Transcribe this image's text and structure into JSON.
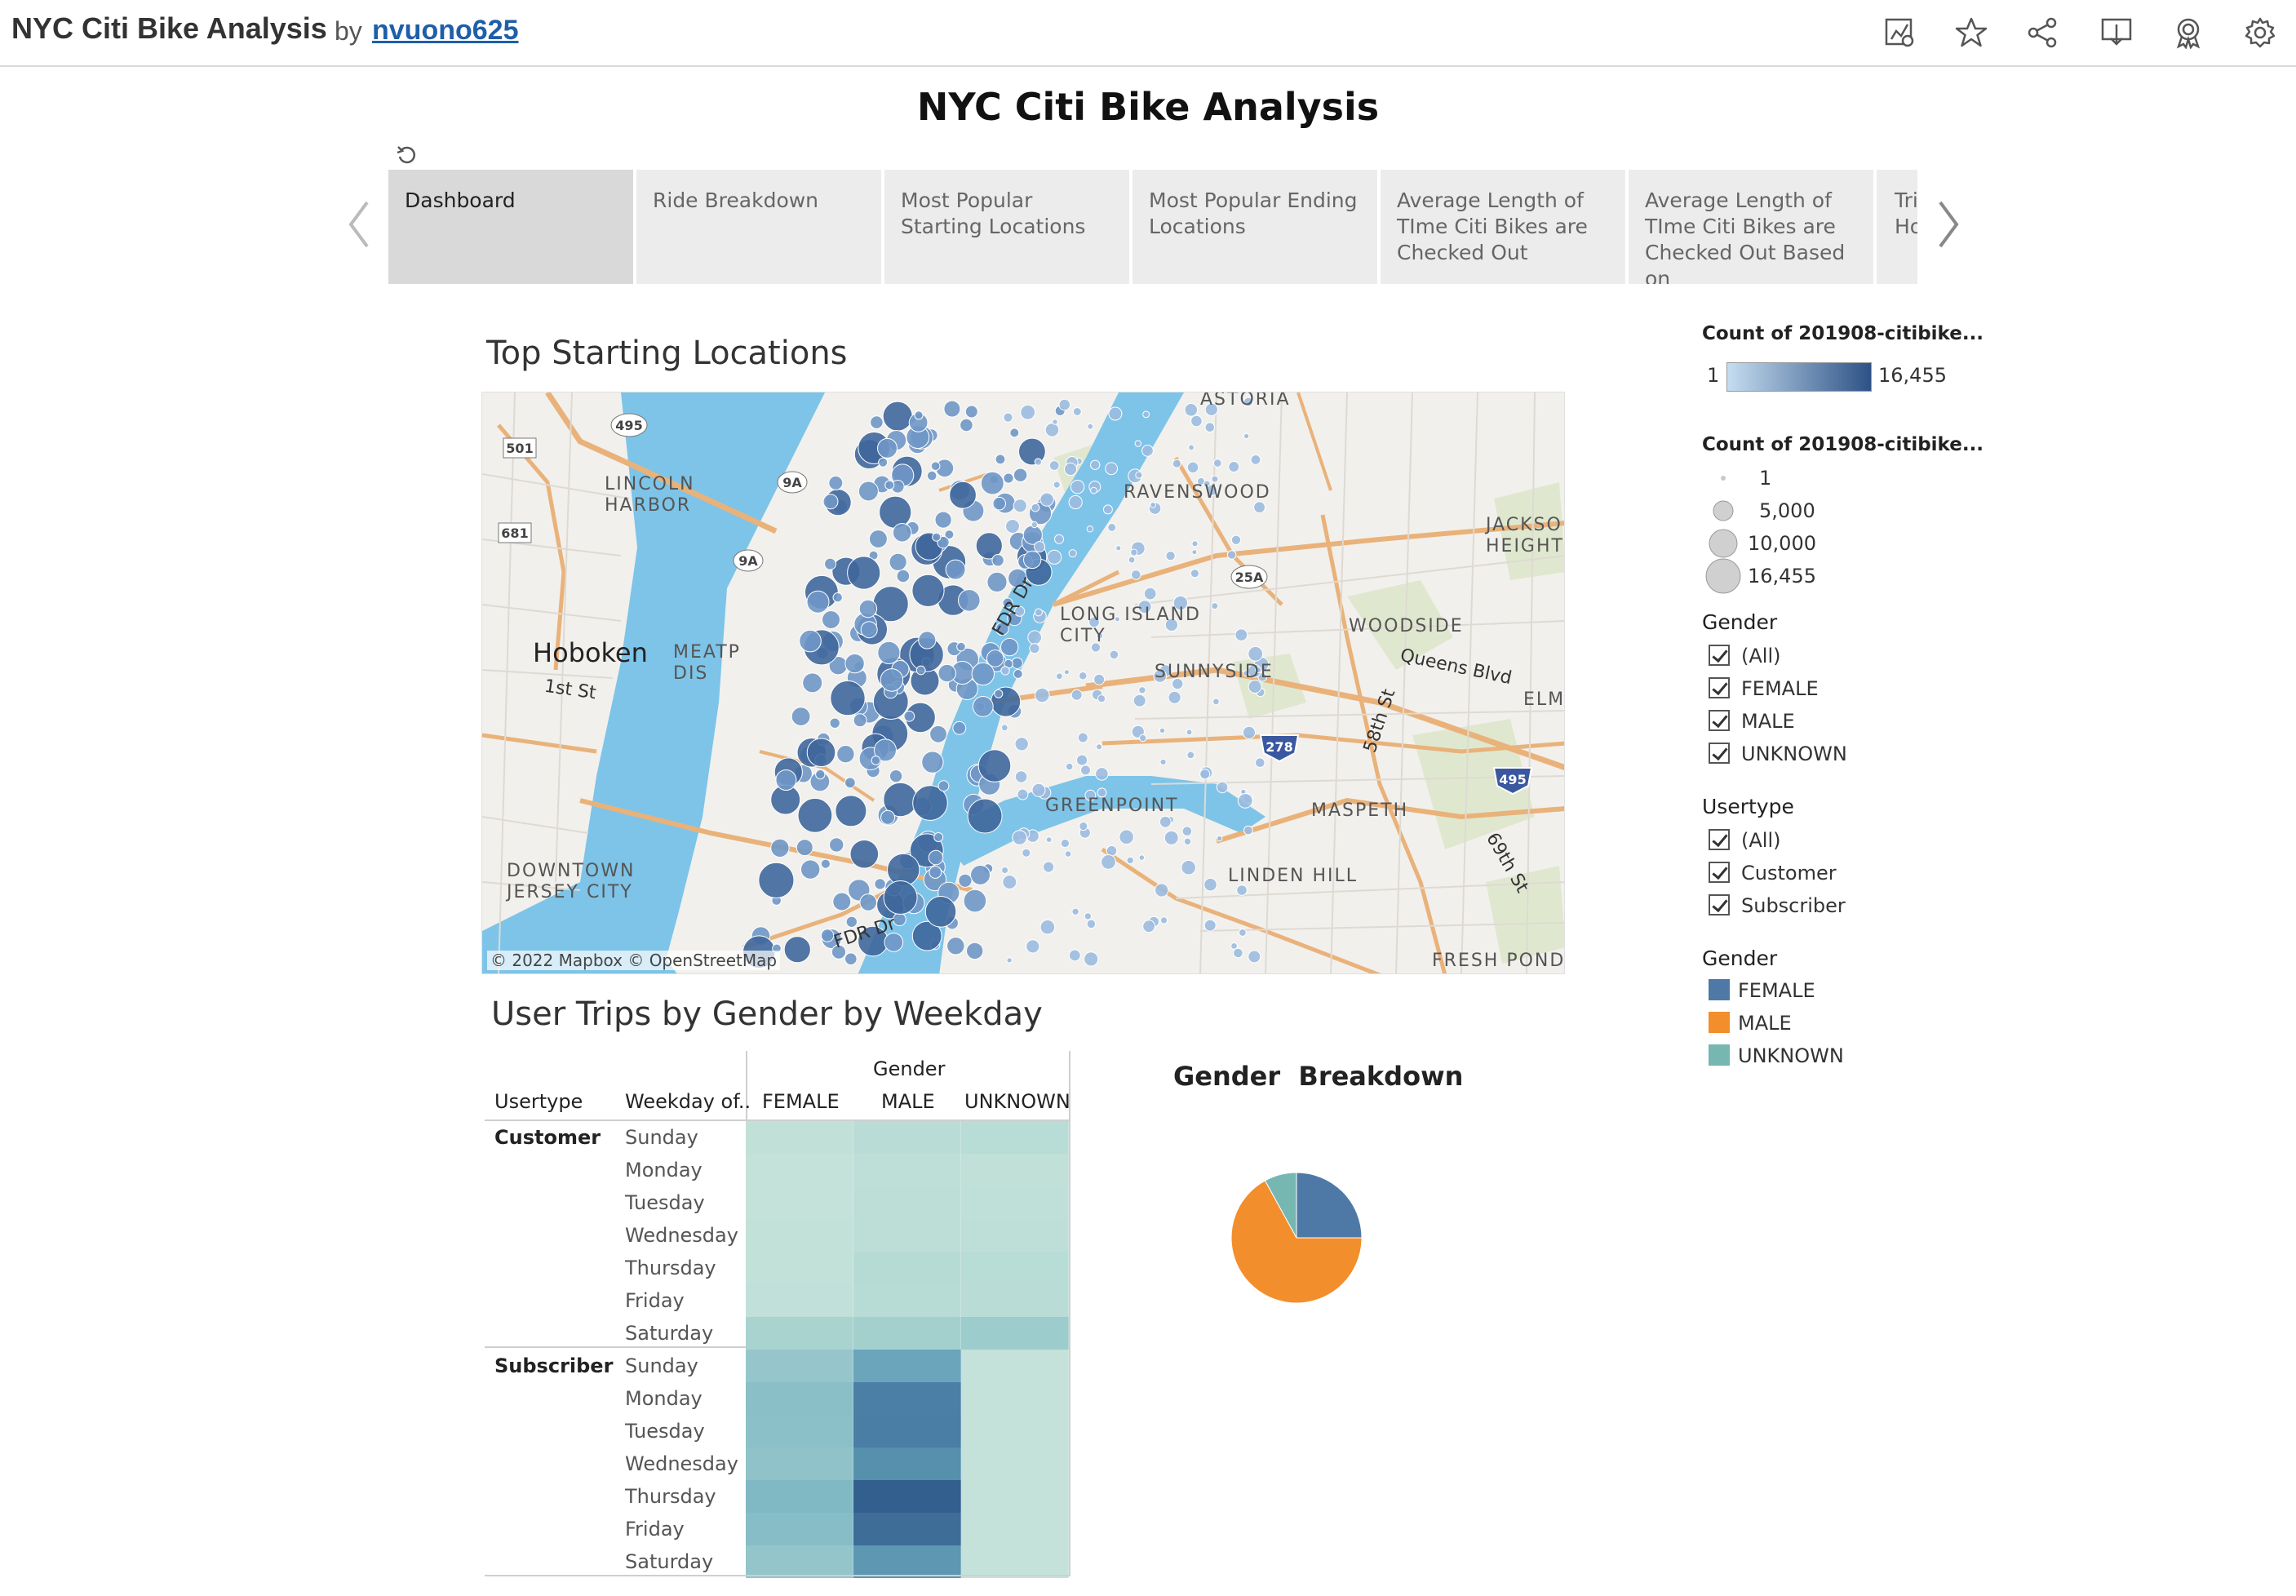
{
  "header": {
    "viz_title": "NYC Citi Bike Analysis",
    "by": "by",
    "author": "nvuono625"
  },
  "toolbar_icons": [
    "data-guide-icon",
    "favorite-star-icon",
    "share-icon",
    "download-icon",
    "metrics-badge-icon",
    "settings-gear-icon"
  ],
  "dashboard": {
    "title": "NYC Citi Bike Analysis"
  },
  "story_tabs": [
    {
      "label": "Dashboard",
      "active": true
    },
    {
      "label": "Ride Breakdown",
      "active": false
    },
    {
      "label": "Most Popular Starting Locations",
      "active": false
    },
    {
      "label": "Most Popular Ending Locations",
      "active": false
    },
    {
      "label": "Average Length of TIme Citi Bikes are Checked Out",
      "active": false
    },
    {
      "label": "Average Length of TIme Citi Bikes are Checked Out Based on",
      "active": false
    },
    {
      "label": "Tri Ho",
      "active": false
    }
  ],
  "map": {
    "title": "Top Starting Locations",
    "attribution": "© 2022 Mapbox  © OpenStreetMap",
    "labels": {
      "hoboken": "Hoboken",
      "lincoln_harbor": "LINCOLN\nHARBOR",
      "astoria": "ASTORIA",
      "ravenswood": "RAVENSWOOD",
      "jackson_heights": "JACKSON\nHEIGHTS",
      "long_island_city": "LONG ISLAND\nCITY",
      "woodside": "WOODSIDE",
      "sunnyside": "SUNNYSIDE",
      "queens_blvd": "Queens Blvd",
      "elm": "ELM",
      "maspeth": "MASPETH",
      "greenpoint": "GREENPOINT",
      "linden_hill": "LINDEN HILL",
      "fresh_pond": "FRESH POND",
      "downtown_jersey_city": "DOWNTOWN\nJERSEY CITY",
      "meatpacking": "MEATP\nDIS",
      "first_st": "1st St",
      "fdr_dr": "FDR Dr",
      "fdr_dr_2": "FDR Dr",
      "st58": "58th St",
      "st69": "69th St"
    },
    "shields": [
      "495",
      "501",
      "681",
      "9A",
      "9A",
      "25A",
      "278",
      "495"
    ],
    "colors": {
      "water": "#7dc4e8",
      "land": "#f2f0ec",
      "park": "#dfe8cf",
      "road": "#e9b27a"
    }
  },
  "legends": {
    "color_legend": {
      "title": "Count of 201908-citibike...",
      "min": "1",
      "max": "16,455"
    },
    "size_legend": {
      "title": "Count of 201908-citibike...",
      "items": [
        "1",
        "5,000",
        "10,000",
        "16,455"
      ]
    },
    "gender_filter": {
      "title": "Gender",
      "items": [
        "(All)",
        "FEMALE",
        "MALE",
        "UNKNOWN"
      ]
    },
    "usertype_filter": {
      "title": "Usertype",
      "items": [
        "(All)",
        "Customer",
        "Subscriber"
      ]
    },
    "gender_colors": {
      "title": "Gender",
      "items": [
        {
          "label": "FEMALE",
          "color": "#4e79a7"
        },
        {
          "label": "MALE",
          "color": "#f28e2b"
        },
        {
          "label": "UNKNOWN",
          "color": "#76b7b2"
        }
      ]
    }
  },
  "table": {
    "title": "User Trips by Gender by Weekday",
    "gender_header": "Gender",
    "col_usertype": "Usertype",
    "col_weekday": "Weekday of..",
    "genders": [
      "FEMALE",
      "MALE",
      "UNKNOWN"
    ],
    "groups": [
      {
        "usertype": "Customer",
        "days": [
          "Sunday",
          "Monday",
          "Tuesday",
          "Wednesday",
          "Thursday",
          "Friday",
          "Saturday"
        ],
        "colors": [
          [
            "#c0e0d8",
            "#b9ddd6",
            "#b8dcd6"
          ],
          [
            "#c4e2da",
            "#bedfd8",
            "#c0e0d8"
          ],
          [
            "#c4e2da",
            "#bcded7",
            "#bfe0d8"
          ],
          [
            "#c2e1d9",
            "#bcded7",
            "#bddfd8"
          ],
          [
            "#c2e1d9",
            "#b6dbd5",
            "#b8dcd6"
          ],
          [
            "#c1e0d9",
            "#b7dcd5",
            "#b9ddd6"
          ],
          [
            "#a9d3cf",
            "#a3d0cd",
            "#9ccccb"
          ]
        ]
      },
      {
        "usertype": "Subscriber",
        "days": [
          "Sunday",
          "Monday",
          "Tuesday",
          "Wednesday",
          "Thursday",
          "Friday",
          "Saturday"
        ],
        "colors": [
          [
            "#96c6cb",
            "#6aa5bb",
            "#c4e2da"
          ],
          [
            "#8bbfc8",
            "#4b7fa6",
            "#c4e2da"
          ],
          [
            "#8cc0c8",
            "#4a7ea5",
            "#c4e2da"
          ],
          [
            "#8fc2c9",
            "#5690ad",
            "#c4e2da"
          ],
          [
            "#80b8c4",
            "#335f8e",
            "#c4e2da"
          ],
          [
            "#87bdc6",
            "#3e6d98",
            "#c4e2da"
          ],
          [
            "#93c5ca",
            "#5d97b1",
            "#c4e2da"
          ]
        ]
      }
    ]
  },
  "pie": {
    "title": "Gender  Breakdown",
    "slices": [
      {
        "label": "FEMALE",
        "value": 0.25,
        "color": "#4e79a7"
      },
      {
        "label": "MALE",
        "value": 0.67,
        "color": "#f28e2b"
      },
      {
        "label": "UNKNOWN",
        "value": 0.08,
        "color": "#76b7b2"
      }
    ]
  }
}
